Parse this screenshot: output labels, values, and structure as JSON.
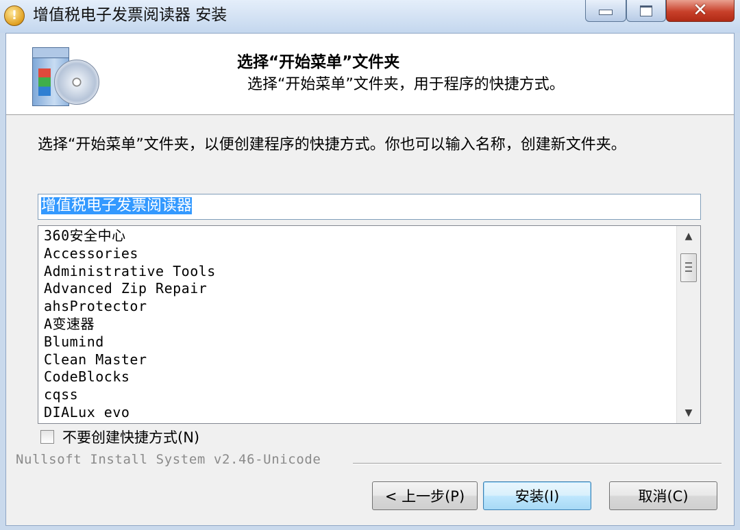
{
  "window": {
    "title": "增值税电子发票阅读器 安装",
    "app_icon_glyph": "!",
    "close_glyph": "✕"
  },
  "header": {
    "title": "选择“开始菜单”文件夹",
    "subtitle": "选择“开始菜单”文件夹，用于程序的快捷方式。"
  },
  "description": "选择“开始菜单”文件夹，以便创建程序的快捷方式。你也可以输入名称，创建新文件夹。",
  "folder_input": {
    "value": "增值税电子发票阅读器"
  },
  "folder_list": {
    "items": [
      "360安全中心",
      "Accessories",
      "Administrative Tools",
      "Advanced Zip Repair",
      "ahsProtector",
      "A变速器",
      "Blumind",
      "Clean Master",
      "CodeBlocks",
      "cqss",
      "DIALux evo"
    ],
    "scroll_up_glyph": "▲",
    "scroll_down_glyph": "▼"
  },
  "no_shortcuts_checkbox": {
    "label": "不要创建快捷方式(N)",
    "checked": false
  },
  "branding": "Nullsoft Install System v2.46-Unicode",
  "buttons": {
    "back": "< 上一步(P)",
    "install": "安装(I)",
    "cancel": "取消(C)"
  }
}
